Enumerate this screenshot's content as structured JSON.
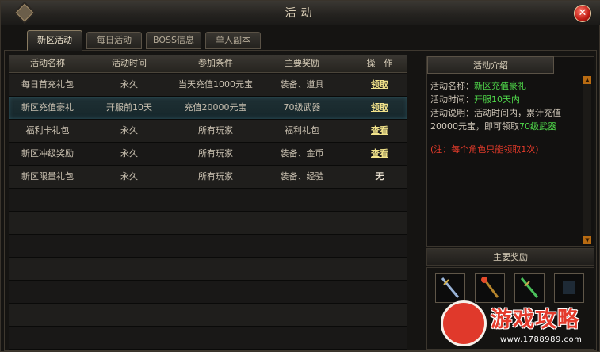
{
  "window": {
    "title": "活动",
    "close_label": "✕"
  },
  "tabs": [
    {
      "label": "新区活动",
      "active": true
    },
    {
      "label": "每日活动",
      "active": false
    },
    {
      "label": "BOSS信息",
      "active": false
    },
    {
      "label": "单人副本",
      "active": false
    }
  ],
  "table": {
    "headers": [
      "活动名称",
      "活动时间",
      "参加条件",
      "主要奖励",
      "操　作"
    ],
    "rows": [
      {
        "name": "每日首充礼包",
        "time": "永久",
        "cond": "当天充值1000元宝",
        "reward": "装备、道具",
        "op": "领取",
        "op_type": "link"
      },
      {
        "name": "新区充值豪礼",
        "time": "开服前10天",
        "cond": "充值20000元宝",
        "reward": "70级武器",
        "op": "领取",
        "op_type": "link"
      },
      {
        "name": "福利卡礼包",
        "time": "永久",
        "cond": "所有玩家",
        "reward": "福利礼包",
        "op": "查看",
        "op_type": "link"
      },
      {
        "name": "新区冲级奖励",
        "time": "永久",
        "cond": "所有玩家",
        "reward": "装备、金币",
        "op": "查看",
        "op_type": "link"
      },
      {
        "name": "新区限量礼包",
        "time": "永久",
        "cond": "所有玩家",
        "reward": "装备、经验",
        "op": "无",
        "op_type": "none"
      }
    ]
  },
  "intro": {
    "header": "活动介绍",
    "name_label": "活动名称：",
    "name_value": "新区充值豪礼",
    "time_label": "活动时间：",
    "time_value": "开服10天内",
    "desc_label": "活动说明：",
    "desc_text": "活动时间内，累计充值20000元宝，即可领取",
    "desc_value": "70级武器",
    "note": "(注：每个角色只能领取1次)"
  },
  "rewards": {
    "header": "主要奖励"
  },
  "watermark": {
    "text": "游戏攻略",
    "url": "www.1788989.com"
  },
  "colors": {
    "highlight_green": "#4fd84a",
    "warning_red": "#e23a2a",
    "link_yellow": "#f2e38a"
  }
}
